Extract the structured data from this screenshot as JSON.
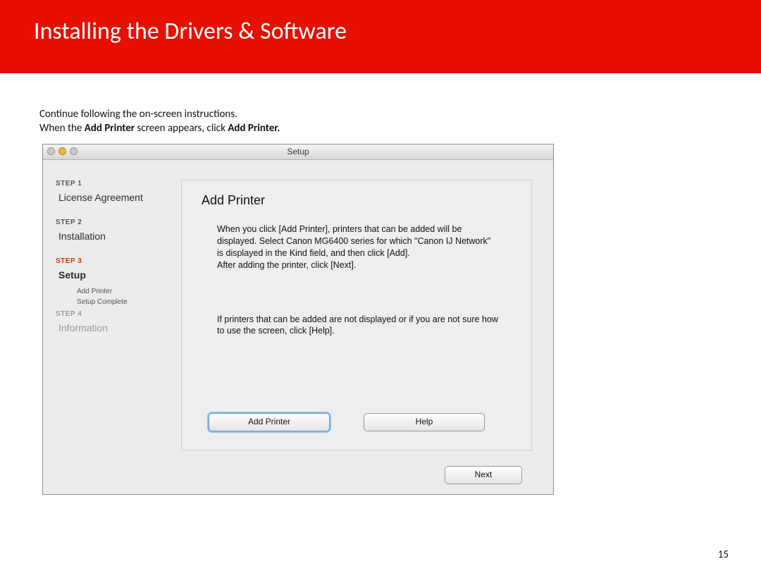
{
  "banner": {
    "title": "Installing  the Drivers & Software"
  },
  "instructions": {
    "line1": "Continue following the on-screen instructions.",
    "line2_before": "When the ",
    "line2_bold1": "Add Printer",
    "line2_mid": " screen appears, click ",
    "line2_bold2": "Add Printer."
  },
  "window": {
    "title": "Setup",
    "sidebar": {
      "step1_label": "STEP 1",
      "step1_item": "License Agreement",
      "step2_label": "STEP 2",
      "step2_item": "Installation",
      "step3_label": "STEP 3",
      "step3_item": "Setup",
      "sub1": "Add Printer",
      "sub2": "Setup Complete",
      "step4_label": "STEP 4",
      "step4_item": "Information"
    },
    "content": {
      "heading": "Add Printer",
      "para1": "When you click [Add Printer], printers that can be added will be displayed. Select Canon MG6400 series for which \"Canon IJ Network\" is displayed in the Kind field, and then click [Add].\nAfter adding the printer, click [Next].",
      "para2": "If printers that can be added are not displayed or if you are not sure how to use the screen, click [Help].",
      "add_button": "Add Printer",
      "help_button": "Help"
    },
    "next_button": "Next"
  },
  "page_number": "15"
}
